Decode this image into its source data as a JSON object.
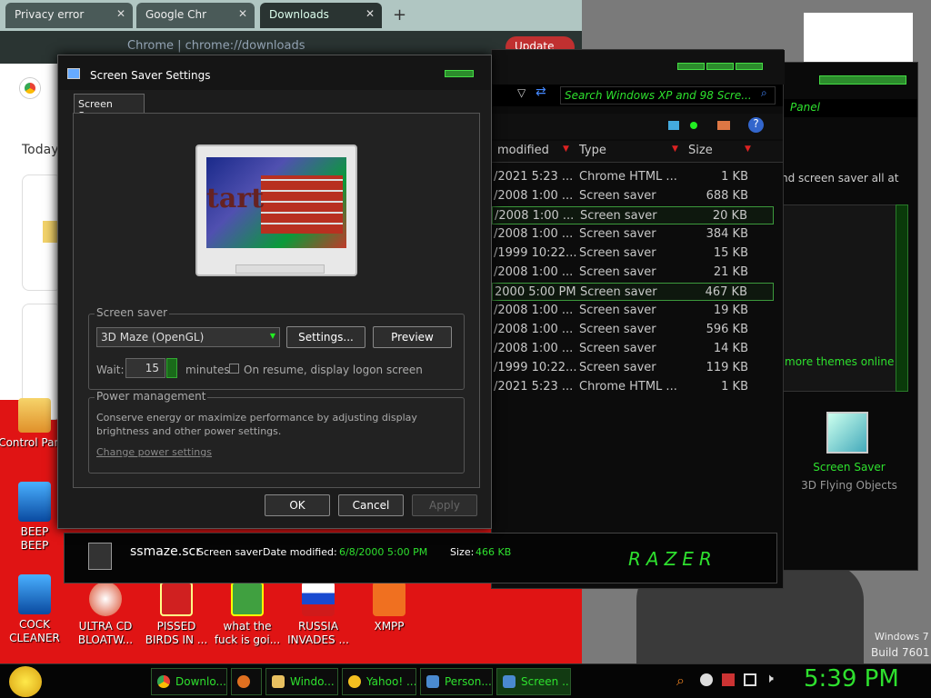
{
  "browser": {
    "tabs": [
      {
        "label": "Privacy error"
      },
      {
        "label": "Google Chr"
      },
      {
        "label": "Downloads"
      }
    ],
    "address_label": "Chrome",
    "address_url": "chrome://downloads",
    "update_label": "Update",
    "today_label": "Today"
  },
  "desktop_icons": [
    {
      "label": "Control Panel"
    },
    {
      "label": "BEEP BEEP"
    },
    {
      "label": "COCK CLEANER"
    },
    {
      "label": "ULTRA CD BLOATW..."
    },
    {
      "label": "PISSED BIRDS IN ..."
    },
    {
      "label": "what the fuck is goi..."
    },
    {
      "label": "RUSSIA INVADES ..."
    },
    {
      "label": "XMPP"
    }
  ],
  "explorer": {
    "search_placeholder": "Search Windows XP and 98 Scre...",
    "columns": {
      "modified": "modified",
      "type": "Type",
      "size": "Size"
    },
    "rows": [
      {
        "date": "/2021 5:23 ...",
        "type": "Chrome HTML ...",
        "size": "1 KB"
      },
      {
        "date": "/2008 1:00 ...",
        "type": "Screen saver",
        "size": "688 KB"
      },
      {
        "date": "/2008 1:00 ...",
        "type": "Screen saver",
        "size": "20 KB"
      },
      {
        "date": "/2008 1:00 ...",
        "type": "Screen saver",
        "size": "384 KB"
      },
      {
        "date": "/1999 10:22...",
        "type": "Screen saver",
        "size": "15 KB"
      },
      {
        "date": "/2008 1:00 ...",
        "type": "Screen saver",
        "size": "21 KB"
      },
      {
        "date": "2000 5:00 PM",
        "type": "Screen saver",
        "size": "467 KB"
      },
      {
        "date": "/2008 1:00 ...",
        "type": "Screen saver",
        "size": "19 KB"
      },
      {
        "date": "/2008 1:00 ...",
        "type": "Screen saver",
        "size": "596 KB"
      },
      {
        "date": "/2008 1:00 ...",
        "type": "Screen saver",
        "size": "14 KB"
      },
      {
        "date": "/1999 10:22...",
        "type": "Screen saver",
        "size": "119 KB"
      },
      {
        "date": "/2021 5:23 ...",
        "type": "Chrome HTML ...",
        "size": "1 KB"
      }
    ]
  },
  "details_bar": {
    "filename": "ssmaze.scr",
    "kind": "Screen saver",
    "date_label": "Date modified:",
    "date_value": "6/8/2000 5:00 PM",
    "size_label": "Size:",
    "size_value": "466 KB",
    "brand": "RAZER"
  },
  "right_panel": {
    "header": "Panel",
    "line1": "nd screen saver all at",
    "link": "more themes online",
    "item_title": "Screen Saver",
    "item_sub": "3D Flying Objects",
    "os_name": "Windows 7",
    "os_build": "Build 7601"
  },
  "dialog": {
    "title": "Screen Saver Settings",
    "tab": "Screen Saver",
    "preview_text": "tart",
    "screen_saver_group": "Screen saver",
    "selected_saver": "3D Maze (OpenGL)",
    "settings_button": "Settings...",
    "preview_button": "Preview",
    "wait_label": "Wait:",
    "wait_value": "15",
    "minutes_label": "minutes",
    "resume_label": "On resume, display logon screen",
    "power_group": "Power management",
    "power_text": "Conserve energy or maximize performance by adjusting display brightness and other power settings.",
    "power_link": "Change power settings",
    "ok": "OK",
    "cancel": "Cancel",
    "apply": "Apply"
  },
  "taskbar": {
    "buttons": [
      {
        "label": "Downlo..."
      },
      {
        "label": ""
      },
      {
        "label": "Windo..."
      },
      {
        "label": "Yahoo! ..."
      },
      {
        "label": "Person..."
      },
      {
        "label": "Screen ..."
      }
    ],
    "clock": "5:39 PM"
  },
  "colors": {
    "accent": "#2ee02e",
    "desktop": "#e01414"
  }
}
